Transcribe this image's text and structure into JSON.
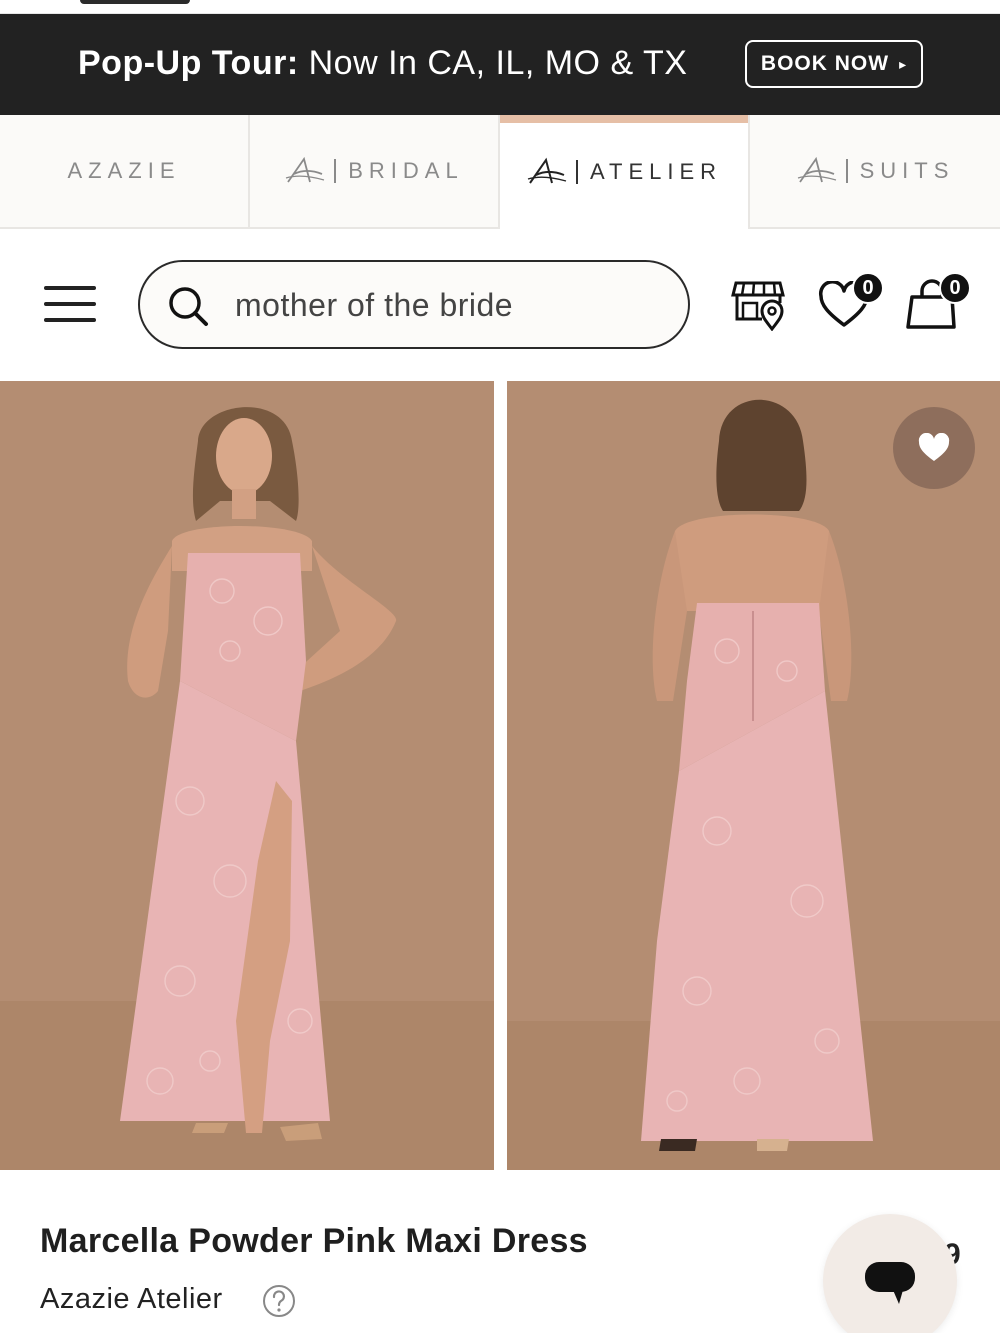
{
  "promo": {
    "label_bold": "Pop-Up Tour:",
    "label_rest": " Now In CA, IL, MO & TX",
    "button_label": "BOOK NOW",
    "button_arrow": "▸"
  },
  "brand_tabs": [
    {
      "label": "AZAZIE",
      "active": false
    },
    {
      "label": "BRIDAL",
      "active": false
    },
    {
      "label": "ATELIER",
      "active": true
    },
    {
      "label": "SUITS",
      "active": false
    }
  ],
  "header": {
    "search_value": "mother of the bride",
    "wishlist_count": "0",
    "cart_count": "0",
    "icons": [
      "menu-icon",
      "search-icon",
      "store-locator-icon",
      "heart-icon",
      "cart-icon"
    ]
  },
  "gallery": {
    "images": [
      "dress-front-photo",
      "dress-back-photo"
    ],
    "favorite_icon": "heart-filled-icon"
  },
  "product": {
    "title": "Marcella Powder Pink Maxi Dress",
    "brand": "Azazie Atelier",
    "help_icon": "question-circle-icon"
  },
  "chat": {
    "icon": "chat-bubble-icon",
    "peek_text": "9"
  },
  "colors": {
    "promo_bg": "#222222",
    "active_tab_accent": "#e6bfa6",
    "photo_backdrop": "#b48d72",
    "dress_pink": "#e8b4b4",
    "chat_bg": "#f2ebe6"
  }
}
